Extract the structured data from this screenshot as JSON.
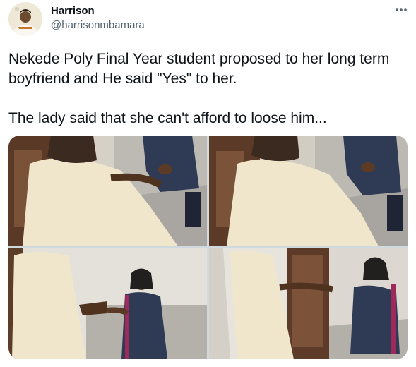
{
  "user": {
    "name": "Harrison",
    "handle": "@harrisonmbamara"
  },
  "tweet": {
    "text": "Nekede Poly Final Year student proposed to her long term boyfriend and He said \"Yes\" to her.\n\nThe lady said that she can't afford to loose him..."
  },
  "icons": {
    "more": "more-dots-icon"
  },
  "media": {
    "count": 4
  },
  "colors": {
    "text": "#0f1419",
    "secondary": "#536471"
  }
}
